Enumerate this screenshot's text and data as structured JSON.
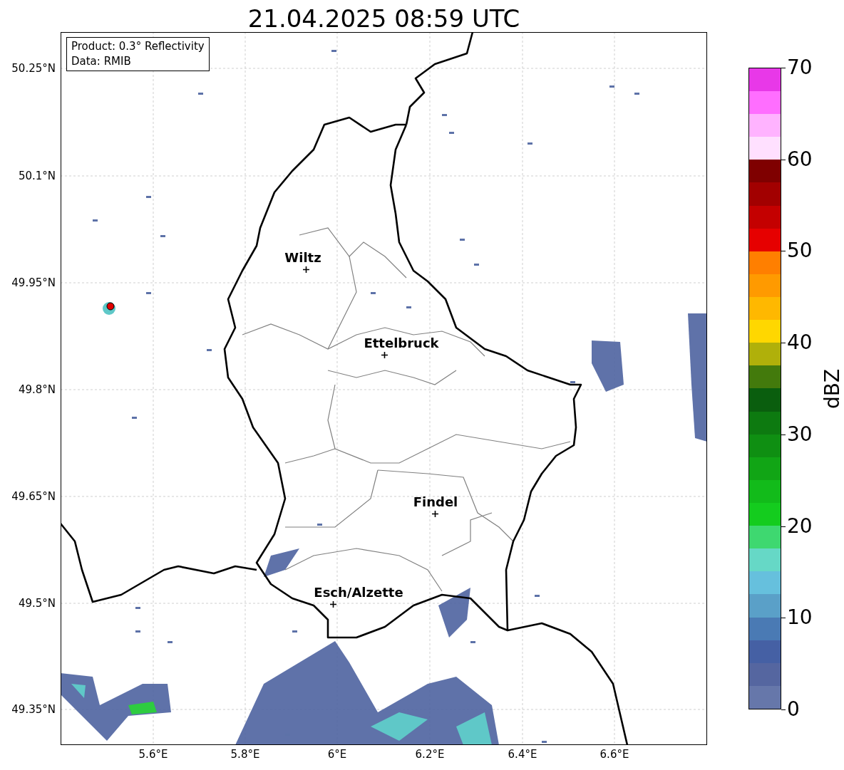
{
  "title": "21.04.2025 08:59 UTC",
  "info_box": {
    "lines": [
      "Product: 0.3° Reflectivity",
      "Data: RMIB"
    ]
  },
  "y_ticks": [
    "50.25°N",
    "50.1°N",
    "49.95°N",
    "49.8°N",
    "49.65°N",
    "49.5°N",
    "49.35°N"
  ],
  "x_ticks": [
    "5.6°E",
    "5.8°E",
    "6°E",
    "6.2°E",
    "6.4°E",
    "6.6°E"
  ],
  "cities": [
    {
      "name": "Wiltz"
    },
    {
      "name": "Ettelbruck"
    },
    {
      "name": "Findel"
    },
    {
      "name": "Esch/Alzette"
    }
  ],
  "colorbar": {
    "label": "dBZ",
    "ticks": [
      "70",
      "60",
      "50",
      "40",
      "30",
      "20",
      "10",
      "0"
    ],
    "bins": [
      {
        "color": "#6677aa"
      },
      {
        "color": "#5566a0"
      },
      {
        "color": "#4560a4"
      },
      {
        "color": "#4a7ab4"
      },
      {
        "color": "#5aa0c8"
      },
      {
        "color": "#66c0dd"
      },
      {
        "color": "#66d8c6"
      },
      {
        "color": "#3ed870"
      },
      {
        "color": "#14cc1e"
      },
      {
        "color": "#12bb1a"
      },
      {
        "color": "#11a515"
      },
      {
        "color": "#0f8f12"
      },
      {
        "color": "#0d7a10"
      },
      {
        "color": "#0a5e0e"
      },
      {
        "color": "#437a0c"
      },
      {
        "color": "#b0b00a"
      },
      {
        "color": "#ffd700"
      },
      {
        "color": "#ffb800"
      },
      {
        "color": "#ff9a00"
      },
      {
        "color": "#ff7f00"
      },
      {
        "color": "#e60000"
      },
      {
        "color": "#c40000"
      },
      {
        "color": "#a20000"
      },
      {
        "color": "#7f0000"
      },
      {
        "color": "#ffe0ff"
      },
      {
        "color": "#ffb3ff"
      },
      {
        "color": "#ff6eff"
      },
      {
        "color": "#e838e8"
      }
    ]
  }
}
